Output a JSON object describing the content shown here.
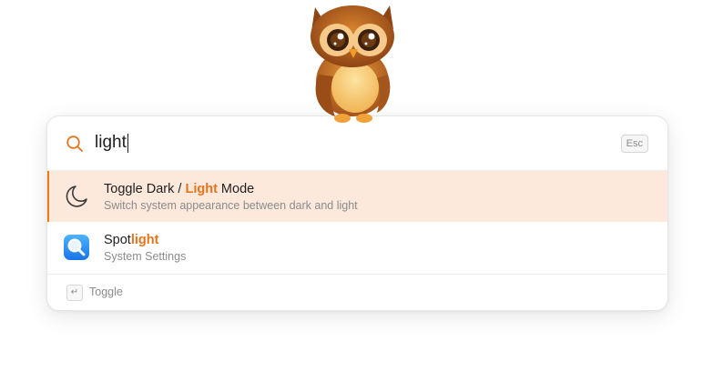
{
  "search": {
    "query": "light",
    "escape_key": "Esc"
  },
  "results": [
    {
      "title_before": "Toggle Dark / ",
      "title_match": "Light",
      "title_after": " Mode",
      "subtitle": "Switch system appearance between dark and light",
      "icon": "moon-icon",
      "selected": true
    },
    {
      "title_before": "Spot",
      "title_match": "light",
      "title_after": "",
      "subtitle": "System Settings",
      "icon": "spotlight-app-icon",
      "selected": false
    }
  ],
  "footer": {
    "enter_key": "↵",
    "action_label": "Toggle"
  },
  "colors": {
    "accent": "#e8731b",
    "selected_background": "#fce9dc",
    "spotlight_icon": "#1f8bf5"
  },
  "mascot": "owl-mascot"
}
